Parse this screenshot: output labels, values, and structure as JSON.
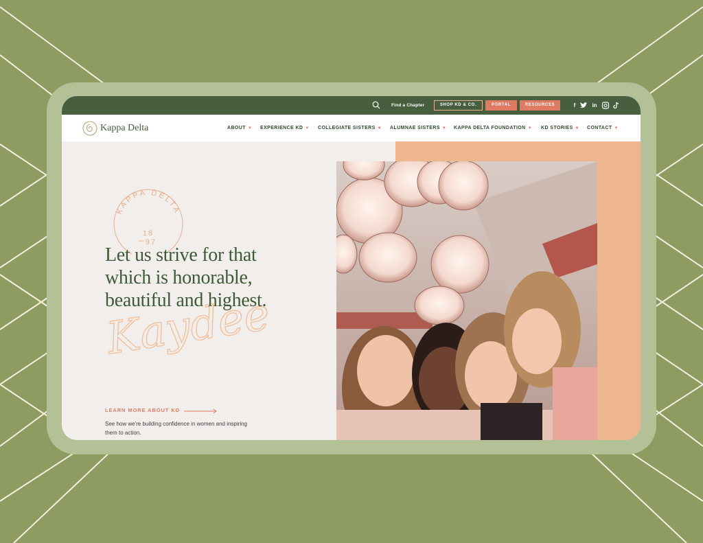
{
  "utility_bar": {
    "find_chapter": "Find a Chapter",
    "shop": "SHOP KD & CO.",
    "portal": "PORTAL",
    "resources": "RESOURCES",
    "social": {
      "facebook": "f",
      "twitter": "twitter-icon",
      "linkedin": "in",
      "instagram": "instagram-icon",
      "tiktok": "tiktok-icon"
    }
  },
  "brand": {
    "name": "Kappa Delta"
  },
  "nav": [
    {
      "label": "ABOUT"
    },
    {
      "label": "EXPERIENCE KD"
    },
    {
      "label": "COLLEGIATE SISTERS"
    },
    {
      "label": "ALUMNAE SISTERS"
    },
    {
      "label": "KAPPA DELTA FOUNDATION"
    },
    {
      "label": "KD STORIES"
    },
    {
      "label": "CONTACT"
    }
  ],
  "hero": {
    "seal_text": "KAPPA DELTA",
    "seal_year_top": "18",
    "seal_year_bottom": "97",
    "headline": [
      "Let us strive for that",
      "which is honorable,",
      "beautiful and highest."
    ],
    "signature": "Kaydee",
    "link_label": "LEARN MORE ABOUT KD",
    "description": "See how we're building confidence in women and inspiring them to action."
  },
  "colors": {
    "page_bg": "#8e9c62",
    "frame": "#b4c196",
    "dark_green": "#475e3f",
    "coral": "#e07a62",
    "peach": "#eeb68e",
    "cream": "#f2eeec"
  }
}
